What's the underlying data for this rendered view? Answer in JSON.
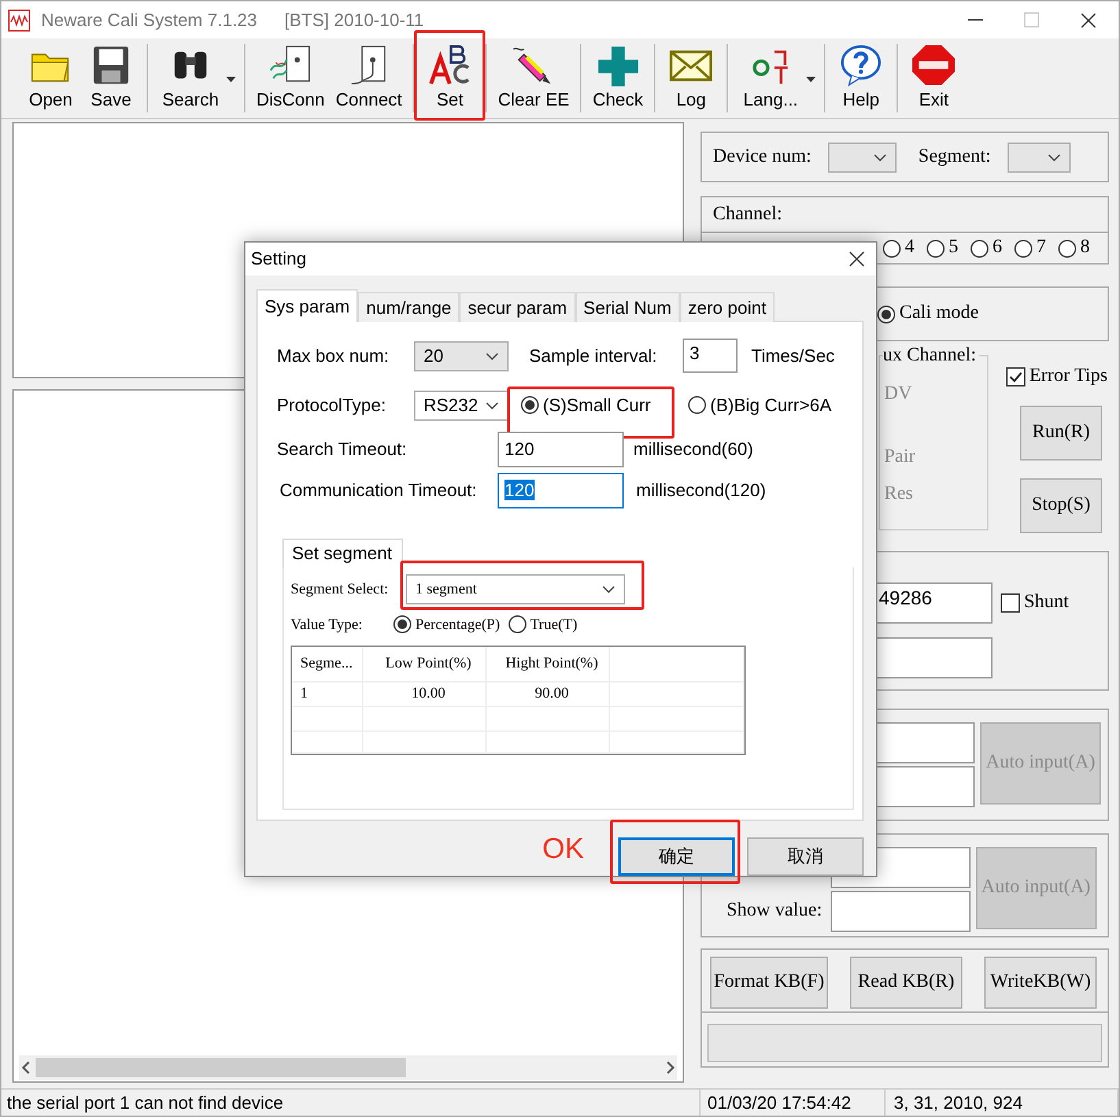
{
  "window": {
    "title": "Neware Cali System 7.1.23",
    "subtitle": "[BTS] 2010-10-11"
  },
  "toolbar_groups": [
    {
      "buttons": [
        {
          "label": "Open",
          "kind": "folder",
          "dropdown": false,
          "highlighted": false
        },
        {
          "label": "Save",
          "kind": "floppy",
          "dropdown": false,
          "highlighted": false
        }
      ]
    },
    {
      "buttons": [
        {
          "label": "Search",
          "kind": "binoculars",
          "dropdown": true,
          "highlighted": false
        }
      ]
    },
    {
      "buttons": [
        {
          "label": "DisConn",
          "kind": "unplug",
          "dropdown": false,
          "highlighted": false
        },
        {
          "label": "Connect",
          "kind": "plug",
          "dropdown": false,
          "highlighted": false
        }
      ]
    },
    {
      "buttons": [
        {
          "label": "Set",
          "kind": "letters",
          "dropdown": false,
          "highlighted": true
        }
      ]
    },
    {
      "buttons": [
        {
          "label": "Clear EE",
          "kind": "pencil",
          "dropdown": false,
          "highlighted": false
        }
      ]
    },
    {
      "buttons": [
        {
          "label": "Check",
          "kind": "cross",
          "dropdown": false,
          "highlighted": false
        }
      ]
    },
    {
      "buttons": [
        {
          "label": "Log",
          "kind": "envelope",
          "dropdown": false,
          "highlighted": false
        }
      ]
    },
    {
      "buttons": [
        {
          "label": "Lang...",
          "kind": "language",
          "dropdown": true,
          "highlighted": false
        }
      ]
    },
    {
      "buttons": [
        {
          "label": "Help",
          "kind": "help",
          "dropdown": false,
          "highlighted": false
        }
      ]
    },
    {
      "buttons": [
        {
          "label": "Exit",
          "kind": "exit",
          "dropdown": false,
          "highlighted": false
        }
      ]
    }
  ],
  "right_panel": {
    "device_num_label": "Device num:",
    "segment_label": "Segment:",
    "channel_label": "Channel:",
    "channels": [
      {
        "label": "4",
        "selected": false
      },
      {
        "label": "5",
        "selected": false
      },
      {
        "label": "6",
        "selected": false
      },
      {
        "label": "7",
        "selected": false
      },
      {
        "label": "8",
        "selected": false
      }
    ],
    "mode": {
      "label": "Cali mode",
      "selected": true
    },
    "aux_label": "ux Channel:",
    "aux_options": [
      {
        "label": "DV",
        "disabled": true
      },
      {
        "label": "Pair",
        "disabled": true
      },
      {
        "label": "Res",
        "disabled": true
      }
    ],
    "error_tips": {
      "label": "Error Tips",
      "checked": true
    },
    "run_button": "Run(R)",
    "stop_button": "Stop(S)",
    "value_field": "49286",
    "shunt": {
      "label": "Shunt",
      "checked": false
    },
    "auto_input_buttons": [
      {
        "label": "Auto input(A)",
        "disabled": true
      },
      {
        "label": "Auto input(A)",
        "disabled": true
      }
    ],
    "show_value_label": "Show value:",
    "kb_buttons": [
      "Format KB(F)",
      "Read KB(R)",
      "WriteKB(W)"
    ],
    "progress": {
      "level": 0
    }
  },
  "status_bar": [
    "the serial port 1 can not find device",
    "01/03/20 17:54:42",
    "3, 31, 2010, 924"
  ],
  "dialog": {
    "title": "Setting",
    "tabs": [
      {
        "label": "Sys param",
        "selected": true
      },
      {
        "label": "num/range",
        "selected": false
      },
      {
        "label": "secur param",
        "selected": false
      },
      {
        "label": "Serial Num",
        "selected": false
      },
      {
        "label": "zero point",
        "selected": false
      }
    ],
    "max_box": {
      "label": "Max box num:",
      "value": "20"
    },
    "sample": {
      "label": "Sample interval:",
      "value": "3",
      "unit": "Times/Sec"
    },
    "protocol": {
      "label": "ProtocolType:",
      "value": "RS232"
    },
    "current_options": [
      {
        "label": "(S)Small Curr",
        "selected": true,
        "highlighted": true
      },
      {
        "label": "(B)Big Curr>6A",
        "selected": false,
        "highlighted": false
      }
    ],
    "search_timeout": {
      "label": "Search Timeout:",
      "value": "120",
      "unit": "millisecond(60)",
      "text_selected": false
    },
    "comm_timeout": {
      "label": "Communication Timeout:",
      "value": "120",
      "unit": "millisecond(120)",
      "text_selected": true
    },
    "segment": {
      "tab": "Set segment",
      "select_label": "Segment Select:",
      "select_value": "1 segment",
      "highlighted": true,
      "value_type_label": "Value Type:",
      "value_types": [
        {
          "label": "Percentage(P)",
          "selected": true
        },
        {
          "label": "True(T)",
          "selected": false
        }
      ],
      "table": {
        "columns": [
          "Segme...",
          "Low Point(%)",
          "Hight Point(%)"
        ],
        "rows": [
          [
            "1",
            "10.00",
            "90.00"
          ]
        ]
      }
    },
    "buttons": [
      {
        "label": "确定",
        "default": true,
        "highlighted": true
      },
      {
        "label": "取消",
        "default": false,
        "highlighted": false
      }
    ],
    "annotation": "OK"
  }
}
